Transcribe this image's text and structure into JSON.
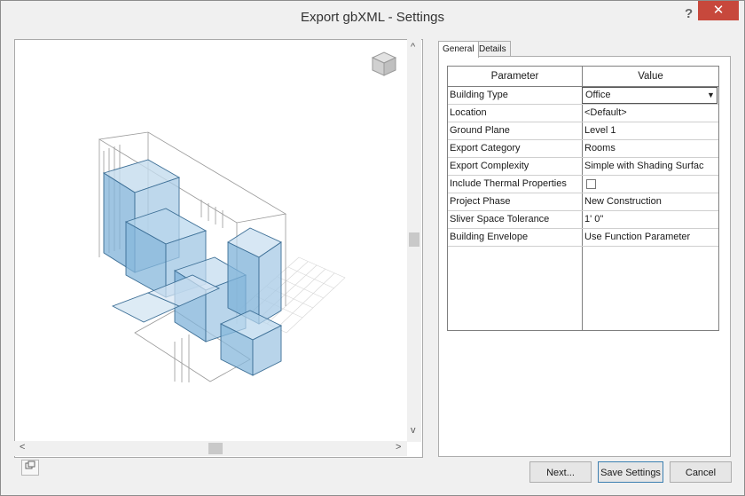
{
  "window": {
    "title": "Export gbXML - Settings",
    "help_label": "?",
    "close_label": "✕"
  },
  "tabs": [
    {
      "label": "General"
    },
    {
      "label": "Details"
    }
  ],
  "grid": {
    "headers": {
      "parameter": "Parameter",
      "value": "Value"
    },
    "rows": [
      {
        "parameter": "Building Type",
        "value": "Office"
      },
      {
        "parameter": "Location",
        "value": "<Default>"
      },
      {
        "parameter": "Ground Plane",
        "value": "Level 1"
      },
      {
        "parameter": "Export Category",
        "value": "Rooms"
      },
      {
        "parameter": "Export Complexity",
        "value": "Simple with Shading Surfac"
      },
      {
        "parameter": "Include Thermal Properties",
        "value": ""
      },
      {
        "parameter": "Project Phase",
        "value": "New Construction"
      },
      {
        "parameter": "Sliver Space Tolerance",
        "value": "1'  0\""
      },
      {
        "parameter": "Building Envelope",
        "value": "Use Function Parameter"
      }
    ]
  },
  "buttons": {
    "next": "Next...",
    "save": "Save Settings",
    "cancel": "Cancel"
  },
  "scroll": {
    "up": "^",
    "down": "v",
    "left": "<",
    "right": ">"
  },
  "icons": {
    "viewcube": "viewcube-icon",
    "view_toggle": "view-toggle-icon"
  }
}
